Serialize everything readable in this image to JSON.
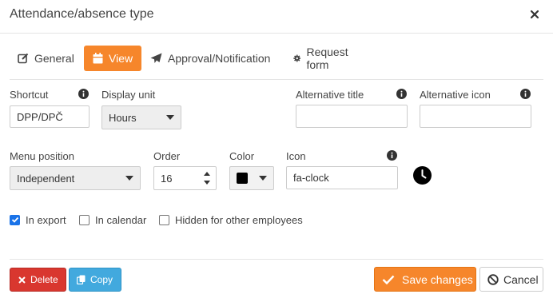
{
  "dialog": {
    "title": "Attendance/absence type"
  },
  "tabs": [
    {
      "label": "General",
      "icon": "edit-icon",
      "active": false
    },
    {
      "label": "View",
      "icon": "calendar-icon",
      "active": true
    },
    {
      "label": "Approval/Notification",
      "icon": "paper-plane-icon",
      "active": false
    },
    {
      "label": "Request form",
      "icon": "gear-icon",
      "active": false
    }
  ],
  "fields": {
    "shortcut": {
      "label": "Shortcut",
      "value": "DPP/DPČ"
    },
    "display_unit": {
      "label": "Display unit",
      "value": "Hours"
    },
    "alternative_title": {
      "label": "Alternative title",
      "value": ""
    },
    "alternative_icon": {
      "label": "Alternative icon",
      "value": ""
    },
    "menu_position": {
      "label": "Menu position",
      "value": "Independent"
    },
    "order": {
      "label": "Order",
      "value": "16"
    },
    "color": {
      "label": "Color",
      "value": "#000000"
    },
    "icon": {
      "label": "Icon",
      "value": "fa-clock",
      "preview_icon": "clock-icon"
    }
  },
  "checkboxes": [
    {
      "label": "In export",
      "checked": true
    },
    {
      "label": "In calendar",
      "checked": false
    },
    {
      "label": "Hidden for other employees",
      "checked": false
    }
  ],
  "buttons": {
    "delete": "Delete",
    "copy": "Copy",
    "save": "Save changes",
    "cancel": "Cancel"
  },
  "colors": {
    "accent": "#f6862b",
    "danger": "#d9372f",
    "info": "#42a9de",
    "checkbox": "#1a73e8"
  }
}
